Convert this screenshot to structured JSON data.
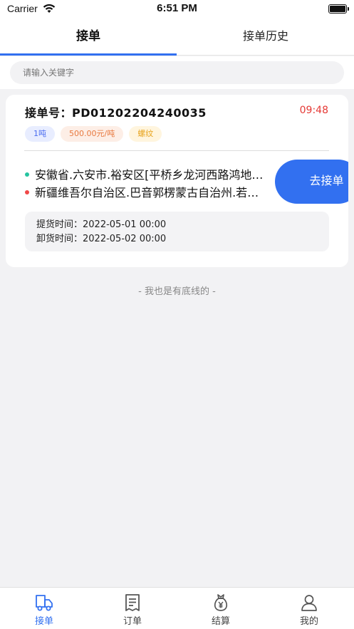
{
  "status_bar": {
    "carrier": "Carrier",
    "time": "6:51 PM"
  },
  "tabs": {
    "active": "接单",
    "history": "接单历史"
  },
  "search": {
    "placeholder": "请输入关键字"
  },
  "order": {
    "number_label": "接单号：",
    "number": "PD01202204240035",
    "countdown": "09:48",
    "tags": {
      "weight": "1吨",
      "price": "500.00元/吨",
      "cargo": "螺纹"
    },
    "from": "安徽省.六安市.裕安区[平桥乡龙河西路鸿地…",
    "to": "新疆维吾尔自治区.巴音郭楞蒙古自治州.若…",
    "accept_label": "去接单",
    "pickup_label": "提货时间：",
    "pickup_time": "2022-05-01 00:00",
    "unload_label": "卸货时间：",
    "unload_time": "2022-05-02 00:00"
  },
  "list_end": "- 我也是有底线的 -",
  "tabbar": {
    "items": [
      {
        "label": "接单",
        "icon": "truck-icon"
      },
      {
        "label": "订单",
        "icon": "document-icon"
      },
      {
        "label": "结算",
        "icon": "money-bag-icon"
      },
      {
        "label": "我的",
        "icon": "person-icon"
      }
    ]
  },
  "colors": {
    "accent": "#3270f0",
    "countdown": "#e53935",
    "origin_dot": "#26c4a0",
    "destination_dot": "#f04848"
  }
}
